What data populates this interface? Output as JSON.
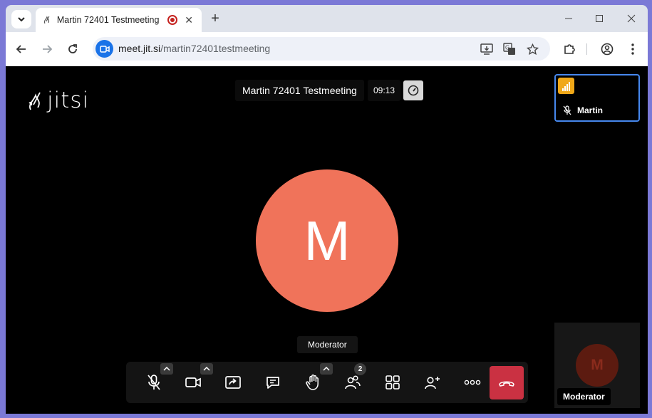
{
  "browser": {
    "tab": {
      "title": "Martin 72401 Testmeeting |"
    },
    "address": {
      "host": "meet.jit.si",
      "path": "/martin72401testmeeting"
    }
  },
  "meeting": {
    "logo_text": "jitsi",
    "title": "Martin 72401 Testmeeting",
    "timer": "09:13",
    "self_thumb_name": "Martin",
    "avatar_initial": "M",
    "moderator_tooltip": "Moderator",
    "bottom_tile_initial": "M",
    "bottom_tile_label": "Moderator",
    "participants_count": "2"
  },
  "colors": {
    "avatar": "#f0735a",
    "hangup": "#ca3142",
    "signal": "#f0a818",
    "active_border": "#4687ed"
  }
}
